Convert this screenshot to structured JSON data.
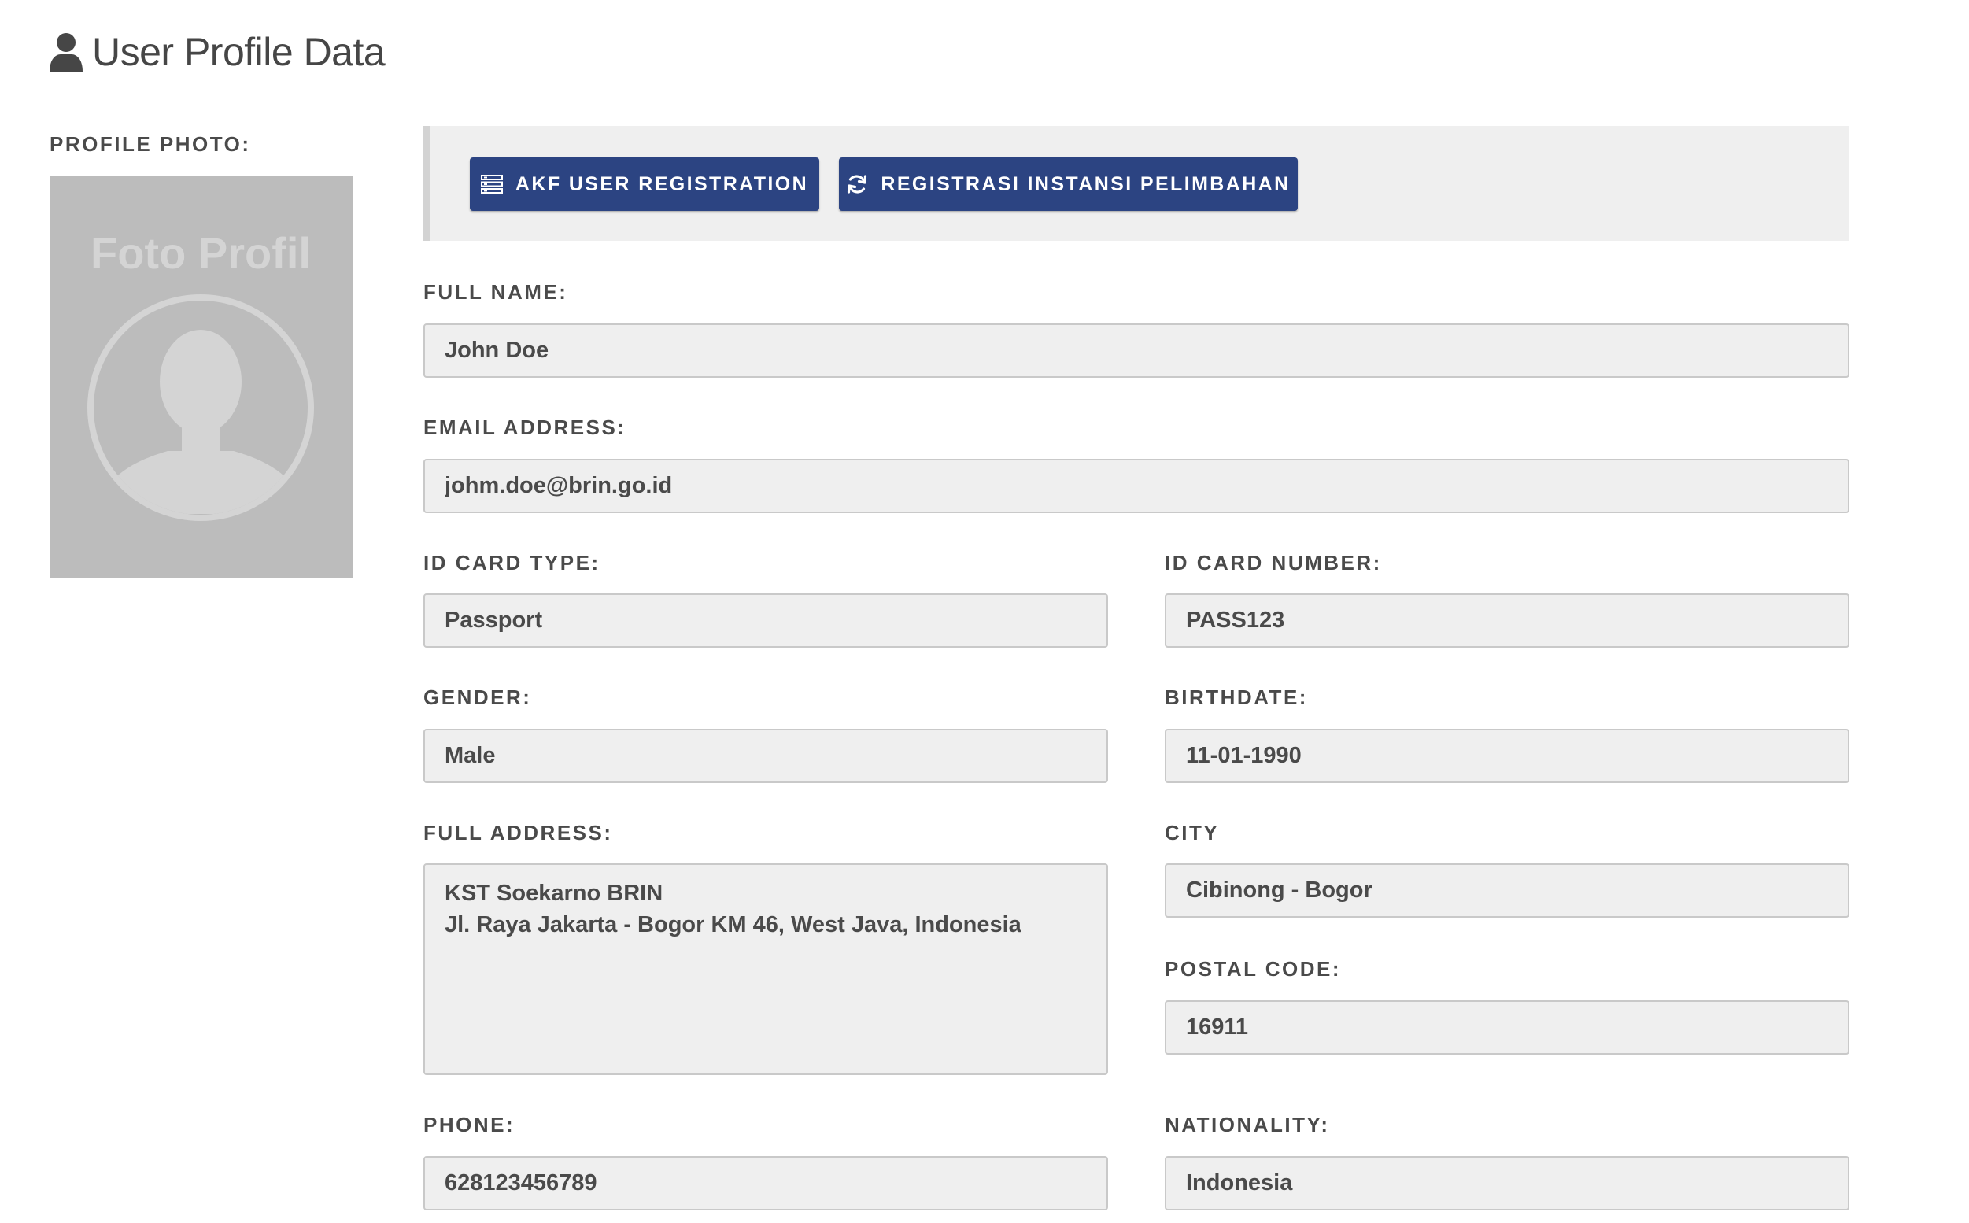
{
  "header": {
    "title": "User Profile Data",
    "icon": "user-icon"
  },
  "photo": {
    "label": "PROFILE PHOTO:",
    "placeholder_text": "Foto Profil",
    "icon": "avatar-silhouette-icon"
  },
  "actions": {
    "akf_label": "AKF USER REGISTRATION",
    "akf_icon": "list-icon",
    "reg_label": "REGISTRASI INSTANSI PELIMBAHAN",
    "reg_icon": "refresh-icon"
  },
  "fields": {
    "full_name": {
      "label": "FULL NAME:",
      "value": "John Doe"
    },
    "email": {
      "label": "EMAIL ADDRESS:",
      "value": "johm.doe@brin.go.id"
    },
    "id_card_type": {
      "label": "ID CARD TYPE:",
      "value": "Passport"
    },
    "id_card_number": {
      "label": "ID CARD NUMBER:",
      "value": "PASS123"
    },
    "gender": {
      "label": "GENDER:",
      "value": "Male"
    },
    "birthdate": {
      "label": "BIRTHDATE:",
      "value": "11-01-1990"
    },
    "full_address": {
      "label": "FULL ADDRESS:",
      "value": "KST Soekarno BRIN\nJl. Raya Jakarta - Bogor KM 46, West Java, Indonesia"
    },
    "city": {
      "label": "CITY",
      "value": "Cibinong - Bogor"
    },
    "postal_code": {
      "label": "POSTAL CODE:",
      "value": "16911"
    },
    "phone": {
      "label": "PHONE:",
      "value": "628123456789"
    },
    "nationality": {
      "label": "NATIONALITY:",
      "value": "Indonesia"
    }
  },
  "colors": {
    "button_bg": "#2c4482",
    "field_bg": "#efefef",
    "field_border": "#c9c9c9",
    "photo_bg": "#bcbcbc",
    "action_bar_bg": "#efefef",
    "text": "#4a4a4a"
  }
}
